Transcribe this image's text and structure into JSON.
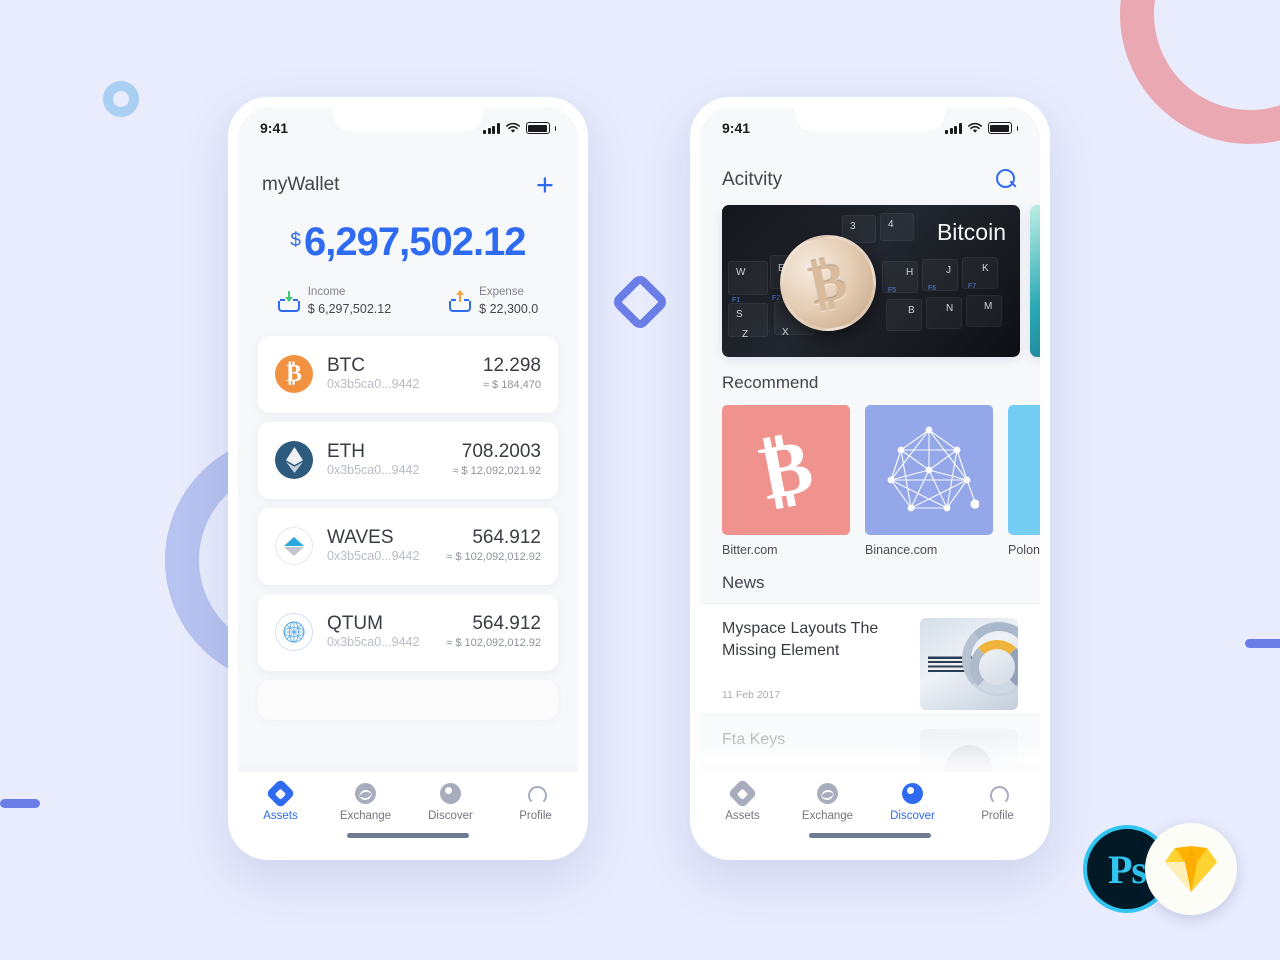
{
  "background": {
    "color": "#e8ecfd"
  },
  "decor": {
    "ring_pink": "pink-ring",
    "ring_periwinkle": "periwinkle-ring",
    "ring_small_blue": "small-blue-ring",
    "diamond": "blue-diamond-outline",
    "bar_left": "blue-pill-left",
    "bar_right": "blue-pill-right"
  },
  "badges": {
    "photoshop_label": "Ps",
    "sketch_label": "Sketch"
  },
  "phone1": {
    "status": {
      "time": "9:41",
      "signal": "signal-icon",
      "wifi": "wifi-icon",
      "battery": "battery-icon"
    },
    "header": {
      "title": "myWallet",
      "add_label": "+"
    },
    "balance": {
      "currency": "$",
      "amount": "6,297,502.12"
    },
    "flows": [
      {
        "label": "Income",
        "value": "$ 6,297,502.12",
        "icon": "income-tray-icon"
      },
      {
        "label": "Expense",
        "value": "$ 22,300.0",
        "icon": "expense-tray-icon"
      }
    ],
    "assets": [
      {
        "symbol": "BTC",
        "address": "0x3b5ca0...9442",
        "amount": "12.298",
        "usd": "≈ $ 184,470",
        "icon": "bitcoin-icon"
      },
      {
        "symbol": "ETH",
        "address": "0x3b5ca0...9442",
        "amount": "708.2003",
        "usd": "≈ $ 12,092,021.92",
        "icon": "ethereum-icon"
      },
      {
        "symbol": "WAVES",
        "address": "0x3b5ca0...9442",
        "amount": "564.912",
        "usd": "≈ $ 102,092,012.92",
        "icon": "waves-icon"
      },
      {
        "symbol": "QTUM",
        "address": "0x3b5ca0...9442",
        "amount": "564.912",
        "usd": "≈ $ 102,092,012.92",
        "icon": "qtum-icon"
      }
    ],
    "tabs": [
      {
        "label": "Assets",
        "icon": "assets-diamond-icon",
        "active": true
      },
      {
        "label": "Exchange",
        "icon": "exchange-wave-icon",
        "active": false
      },
      {
        "label": "Discover",
        "icon": "discover-circle-icon",
        "active": false
      },
      {
        "label": "Profile",
        "icon": "profile-person-icon",
        "active": false
      }
    ]
  },
  "phone2": {
    "status": {
      "time": "9:41",
      "signal": "signal-icon",
      "wifi": "wifi-icon",
      "battery": "battery-icon"
    },
    "header": {
      "title": "Acitvity",
      "search_icon": "search-icon"
    },
    "banners": [
      {
        "caption": "Bitcoin",
        "image": "bitcoin-coin-on-keyboard-photo"
      },
      {
        "caption": "",
        "image": "teal-abstract-photo"
      }
    ],
    "recommend": {
      "section_title": "Recommend",
      "items": [
        {
          "label": "Bitter.com",
          "icon": "bitcoin-glyph-icon",
          "color": "#f0938f"
        },
        {
          "label": "Binance.com",
          "icon": "network-graph-icon",
          "color": "#94a7e8"
        },
        {
          "label": "Polon",
          "icon": "poloniex-icon",
          "color": "#74cdf2"
        }
      ]
    },
    "news": {
      "section_title": "News",
      "items": [
        {
          "title": "Myspace Layouts The Missing Element",
          "date": "11 Feb 2017",
          "thumb": "ibm-server-coil-photo"
        },
        {
          "title": "Fta Keys",
          "date": "",
          "thumb": "person-portrait-photo"
        }
      ]
    },
    "tabs": [
      {
        "label": "Assets",
        "icon": "assets-diamond-icon",
        "active": false
      },
      {
        "label": "Exchange",
        "icon": "exchange-wave-icon",
        "active": false
      },
      {
        "label": "Discover",
        "icon": "discover-circle-icon",
        "active": true
      },
      {
        "label": "Profile",
        "icon": "profile-person-icon",
        "active": false
      }
    ]
  },
  "colors": {
    "accent": "#2f6bf0",
    "muted": "#a7adbd",
    "income": "#3ec97a",
    "expense": "#f5a13c"
  }
}
